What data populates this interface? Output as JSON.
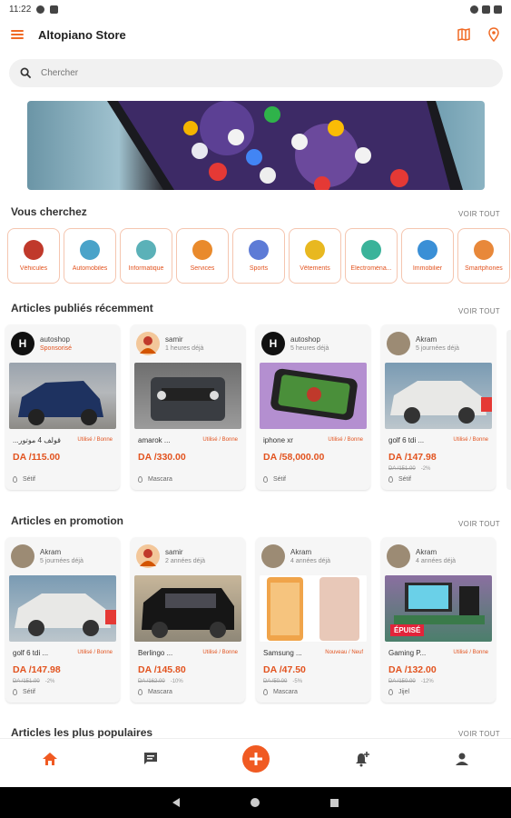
{
  "status": {
    "time": "11:22"
  },
  "app": {
    "title": "Altopiano Store"
  },
  "search": {
    "placeholder": "Chercher"
  },
  "colors": {
    "accent": "#f05a22",
    "text": "#222222"
  },
  "sections": {
    "looking_for": {
      "title": "Vous cherchez",
      "see_all": "VOIR TOUT"
    },
    "recent": {
      "title": "Articles publiés récemment",
      "see_all": "VOIR TOUT"
    },
    "promo": {
      "title": "Articles en promotion",
      "see_all": "VOIR TOUT"
    },
    "popular": {
      "title": "Articles les plus populaires",
      "see_all": "VOIR TOUT"
    }
  },
  "categories": [
    {
      "label": "Véhicules",
      "icon": "car-icon"
    },
    {
      "label": "Automobiles",
      "icon": "car-parts-icon"
    },
    {
      "label": "Informatique",
      "icon": "computer-icon"
    },
    {
      "label": "Services",
      "icon": "services-icon"
    },
    {
      "label": "Sports",
      "icon": "sports-icon"
    },
    {
      "label": "Vêtements",
      "icon": "clothes-icon"
    },
    {
      "label": "Electroména...",
      "icon": "appliance-icon"
    },
    {
      "label": "Immobilier",
      "icon": "house-icon"
    },
    {
      "label": "Smartphones",
      "icon": "phone-icon"
    }
  ],
  "recent": [
    {
      "user": "autoshop",
      "sub": "Sponsorisé",
      "title": "...قولف 4 موتور",
      "cond": "Utilisé / Bonne",
      "price": "DA /115.00",
      "old": "",
      "pct": "",
      "loc": "Sétif"
    },
    {
      "user": "samir",
      "sub": "1 heures déjà",
      "title": "amarok ...",
      "cond": "Utilisé / Bonne",
      "price": "DA /330.00",
      "old": "",
      "pct": "",
      "loc": "Mascara"
    },
    {
      "user": "autoshop",
      "sub": "5 heures déjà",
      "title": "iphone xr",
      "cond": "Utilisé / Bonne",
      "price": "DA /58,000.00",
      "old": "",
      "pct": "",
      "loc": "Sétif"
    },
    {
      "user": "Akram",
      "sub": "5 journées déjà",
      "title": "golf 6 tdi ...",
      "cond": "Utilisé / Bonne",
      "price": "DA /147.98",
      "old": "DA /151.00",
      "pct": "-2%",
      "loc": "Sétif"
    }
  ],
  "promo": [
    {
      "user": "Akram",
      "sub": "5 journées déjà",
      "title": "golf 6 tdi ...",
      "cond": "Utilisé / Bonne",
      "price": "DA /147.98",
      "old": "DA /151.00",
      "pct": "-2%",
      "loc": "Sétif"
    },
    {
      "user": "samir",
      "sub": "2 années déjà",
      "title": "Berlingo ...",
      "cond": "Utilisé / Bonne",
      "price": "DA /145.80",
      "old": "DA /162.00",
      "pct": "-10%",
      "loc": "Mascara"
    },
    {
      "user": "Akram",
      "sub": "4 années déjà",
      "title": "Samsung ...",
      "cond": "Nouveau / Neuf",
      "price": "DA /47.50",
      "old": "DA /50.00",
      "pct": "-5%",
      "loc": "Mascara"
    },
    {
      "user": "Akram",
      "sub": "4 années déjà",
      "title": "Gaming P...",
      "cond": "Utilisé / Bonne",
      "price": "DA /132.00",
      "old": "DA /150.00",
      "pct": "-12%",
      "loc": "Jijel",
      "badge": "ÉPUISÉ"
    }
  ]
}
